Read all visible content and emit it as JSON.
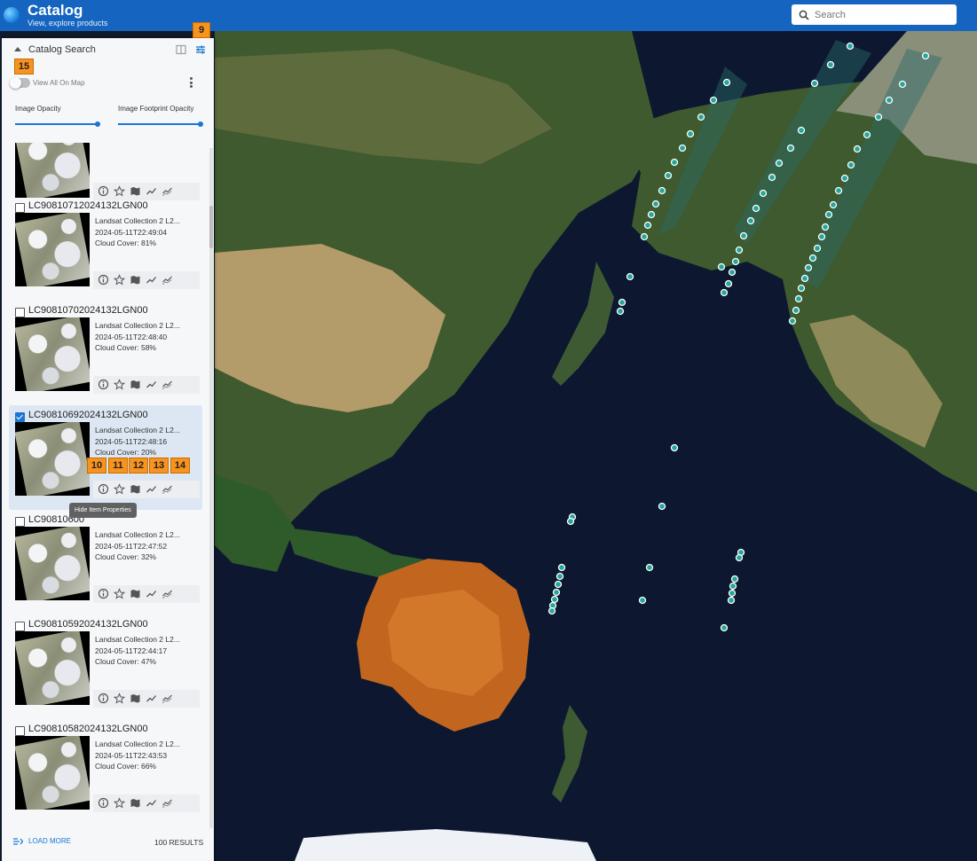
{
  "app": {
    "title": "Catalog",
    "subtitle": "View, explore products"
  },
  "search": {
    "placeholder": "Search"
  },
  "panel": {
    "title": "Catalog Search",
    "view_all_label": "View All On Map",
    "image_opacity_label": "Image Opacity",
    "footprint_opacity_label": "Image Footprint Opacity",
    "image_opacity": 100,
    "footprint_opacity": 100
  },
  "items": [
    {
      "id": "",
      "collection": "",
      "datetime": "",
      "cloud": "",
      "checked": false
    },
    {
      "id": "LC90810712024132LGN00",
      "collection": "Landsat Collection 2 L2...",
      "datetime": "2024-05-11T22:49:04",
      "cloud": "Cloud Cover: 81%",
      "checked": false
    },
    {
      "id": "LC90810702024132LGN00",
      "collection": "Landsat Collection 2 L2...",
      "datetime": "2024-05-11T22:48:40",
      "cloud": "Cloud Cover: 58%",
      "checked": false
    },
    {
      "id": "LC90810692024132LGN00",
      "collection": "Landsat Collection 2 L2...",
      "datetime": "2024-05-11T22:48:16",
      "cloud": "Cloud Cover: 20%",
      "checked": true
    },
    {
      "id": "LC90810600",
      "collection": "Landsat Collection 2 L2...",
      "datetime": "2024-05-11T22:47:52",
      "cloud": "Cloud Cover: 32%",
      "checked": false
    },
    {
      "id": "LC90810592024132LGN00",
      "collection": "Landsat Collection 2 L2...",
      "datetime": "2024-05-11T22:44:17",
      "cloud": "Cloud Cover: 47%",
      "checked": false
    },
    {
      "id": "LC90810582024132LGN00",
      "collection": "Landsat Collection 2 L2...",
      "datetime": "2024-05-11T22:43:53",
      "cloud": "Cloud Cover: 66%",
      "checked": false
    }
  ],
  "item_actions": [
    "info-icon",
    "star-icon",
    "map-icon",
    "trend-icon",
    "compare-icon"
  ],
  "tooltip": "Hide Item Properties",
  "footer": {
    "load_more": "LOAD MORE",
    "results": "100 RESULTS"
  },
  "badges": {
    "filter": "9",
    "toggle": "15",
    "info": "10",
    "star": "11",
    "map": "12",
    "trend": "13",
    "compare": "14"
  },
  "colors": {
    "header": "#1565c0",
    "accent": "#1976d2",
    "badge": "#f7931e",
    "footprint": "#26a69a"
  }
}
